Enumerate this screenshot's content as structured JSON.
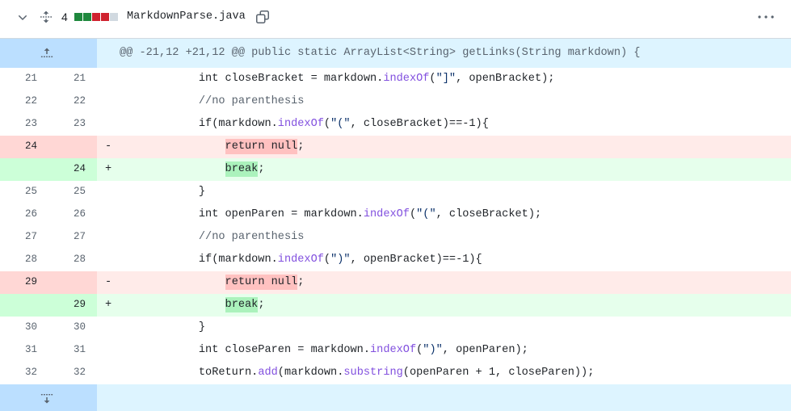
{
  "theme": {
    "text": "#1f2328",
    "muted": "#59636e",
    "border": "#d1d9e0",
    "added": "#1f883d",
    "deleted": "#cf222e",
    "neutral": "#d1d9e0",
    "hunk_num_bg": "#bbdfff",
    "hunk_line_bg": "#ddf4ff",
    "add_num_bg": "#ccffd8",
    "add_line_bg": "#e6ffec",
    "add_word_bg": "#abf2bc",
    "del_num_bg": "#ffd7d5",
    "del_line_bg": "#ffebe9",
    "del_word_bg": "#ffc1c0"
  },
  "file": {
    "change_count": "4",
    "diffstat": {
      "added": 2,
      "deleted": 2,
      "neutral": 1
    },
    "name": "MarkdownParse.java",
    "icons": {
      "collapse": "chevron-down-icon",
      "expand_all": "unfold-icon",
      "copy": "copy-icon",
      "menu": "kebab-horizontal-icon"
    }
  },
  "hunk": {
    "header": "@@ -21,12 +21,12 @@ public static ArrayList<String> getLinks(String markdown) {",
    "expand_icon": "fold-up-icon"
  },
  "lines": [
    {
      "old": "21",
      "new": "21",
      "marker": "",
      "tokens": [
        {
          "t": "            int closeBracket = markdown."
        },
        {
          "t": "indexOf",
          "color": "#8250df"
        },
        {
          "t": "("
        },
        {
          "t": "\"]\"",
          "color": "#0a3069"
        },
        {
          "t": ", openBracket);"
        }
      ]
    },
    {
      "old": "22",
      "new": "22",
      "marker": "",
      "tokens": [
        {
          "t": "            //no parenthesis",
          "color": "#59636e"
        }
      ]
    },
    {
      "old": "23",
      "new": "23",
      "marker": "",
      "tokens": [
        {
          "t": "            if(markdown."
        },
        {
          "t": "indexOf",
          "color": "#8250df"
        },
        {
          "t": "("
        },
        {
          "t": "\"(\"",
          "color": "#0a3069"
        },
        {
          "t": ", closeBracket)==-1){"
        }
      ]
    },
    {
      "old": "24",
      "new": "",
      "marker": "-",
      "tokens": [
        {
          "t": "                "
        },
        {
          "t": "return null",
          "hl": true
        },
        {
          "t": ";"
        }
      ]
    },
    {
      "old": "",
      "new": "24",
      "marker": "+",
      "tokens": [
        {
          "t": "                "
        },
        {
          "t": "break",
          "hl": true
        },
        {
          "t": ";"
        }
      ]
    },
    {
      "old": "25",
      "new": "25",
      "marker": "",
      "tokens": [
        {
          "t": "            }"
        }
      ]
    },
    {
      "old": "26",
      "new": "26",
      "marker": "",
      "tokens": [
        {
          "t": "            int openParen = markdown."
        },
        {
          "t": "indexOf",
          "color": "#8250df"
        },
        {
          "t": "("
        },
        {
          "t": "\"(\"",
          "color": "#0a3069"
        },
        {
          "t": ", closeBracket);"
        }
      ]
    },
    {
      "old": "27",
      "new": "27",
      "marker": "",
      "tokens": [
        {
          "t": "            //no parenthesis",
          "color": "#59636e"
        }
      ]
    },
    {
      "old": "28",
      "new": "28",
      "marker": "",
      "tokens": [
        {
          "t": "            if(markdown."
        },
        {
          "t": "indexOf",
          "color": "#8250df"
        },
        {
          "t": "("
        },
        {
          "t": "\")\"",
          "color": "#0a3069"
        },
        {
          "t": ", openBracket)==-1){"
        }
      ]
    },
    {
      "old": "29",
      "new": "",
      "marker": "-",
      "tokens": [
        {
          "t": "                "
        },
        {
          "t": "return null",
          "hl": true
        },
        {
          "t": ";"
        }
      ]
    },
    {
      "old": "",
      "new": "29",
      "marker": "+",
      "tokens": [
        {
          "t": "                "
        },
        {
          "t": "break",
          "hl": true
        },
        {
          "t": ";"
        }
      ]
    },
    {
      "old": "30",
      "new": "30",
      "marker": "",
      "tokens": [
        {
          "t": "            }"
        }
      ]
    },
    {
      "old": "31",
      "new": "31",
      "marker": "",
      "tokens": [
        {
          "t": "            int closeParen = markdown."
        },
        {
          "t": "indexOf",
          "color": "#8250df"
        },
        {
          "t": "("
        },
        {
          "t": "\")\"",
          "color": "#0a3069"
        },
        {
          "t": ", openParen);"
        }
      ]
    },
    {
      "old": "32",
      "new": "32",
      "marker": "",
      "tokens": [
        {
          "t": "            toReturn."
        },
        {
          "t": "add",
          "color": "#8250df"
        },
        {
          "t": "(markdown."
        },
        {
          "t": "substring",
          "color": "#8250df"
        },
        {
          "t": "(openParen + 1, closeParen));"
        }
      ]
    }
  ],
  "footer": {
    "expand_icon": "fold-down-icon"
  }
}
